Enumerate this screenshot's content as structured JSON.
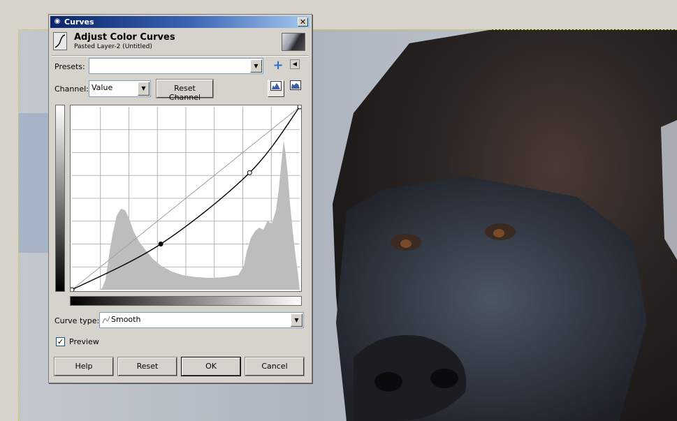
{
  "window": {
    "title": "Curves"
  },
  "header": {
    "title": "Adjust Color Curves",
    "subtitle": "Pasted Layer-2 (Untitled)"
  },
  "presets": {
    "label": "Presets:",
    "value": ""
  },
  "channel": {
    "label": "Channel:",
    "value": "Value",
    "reset_label": "Reset Channel"
  },
  "curve_type": {
    "label": "Curve type:",
    "value": "Smooth"
  },
  "preview": {
    "label": "Preview",
    "checked": true
  },
  "buttons": {
    "help": "Help",
    "reset": "Reset",
    "ok": "OK",
    "cancel": "Cancel"
  },
  "icons": {
    "window": "eye-icon",
    "close": "close-icon",
    "header": "curves-tool-icon",
    "add_preset": "plus-icon",
    "preset_menu": "menu-arrow-icon",
    "linear_hist": "linear-histogram-icon",
    "log_hist": "log-histogram-icon"
  },
  "curve": {
    "points": [
      [
        0,
        0
      ],
      [
        0.39,
        0.25
      ],
      [
        0.78,
        0.64
      ],
      [
        1,
        1
      ]
    ],
    "colors": {
      "curve": "#000000",
      "grid": "#a0a0a0",
      "histogram": "#bdbdbd"
    }
  }
}
